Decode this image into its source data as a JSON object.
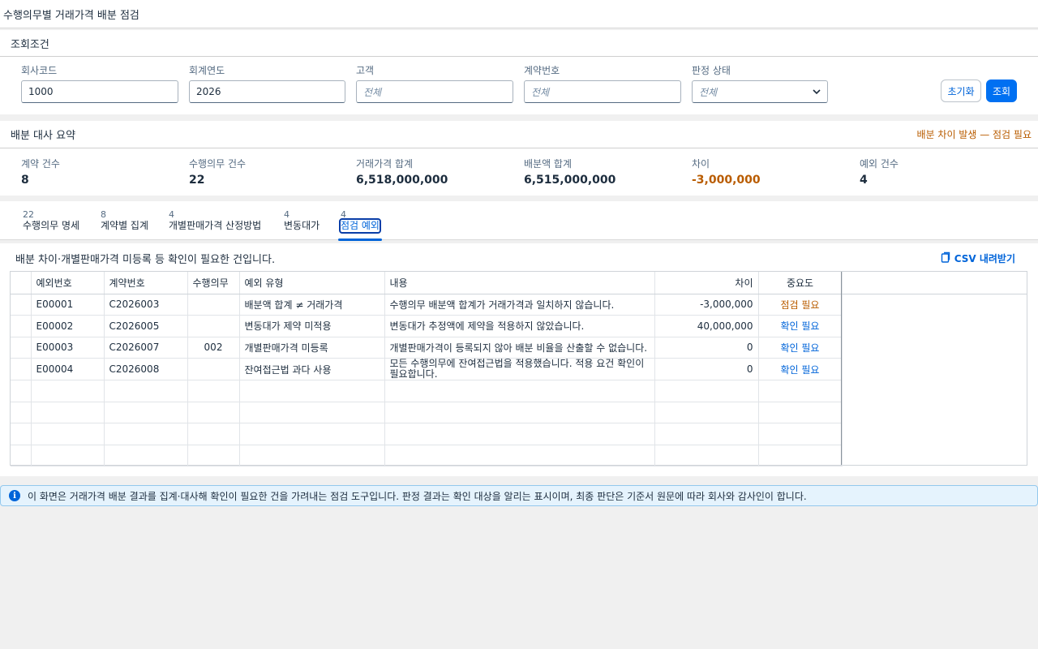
{
  "app": {
    "title": "수행의무별 거래가격 배분 점검"
  },
  "filter": {
    "header": "조회조건",
    "fields": [
      {
        "label": "회사코드",
        "value": "1000"
      },
      {
        "label": "회계연도",
        "value": "2026"
      },
      {
        "label": "고객",
        "placeholder": "전체"
      },
      {
        "label": "계약번호",
        "placeholder": "전체"
      },
      {
        "label": "판정 상태",
        "placeholder": "전체"
      }
    ],
    "reset_label": "초기화",
    "search_label": "조회"
  },
  "summary": {
    "header": "배분 대사 요약",
    "warning": "배분 차이 발생 — 점검 필요",
    "kpis": [
      {
        "label": "계약 건수",
        "value": "8"
      },
      {
        "label": "수행의무 건수",
        "value": "22"
      },
      {
        "label": "거래가격 합계",
        "value": "6,518,000,000"
      },
      {
        "label": "배분액 합계",
        "value": "6,515,000,000"
      },
      {
        "label": "차이",
        "value": "-3,000,000"
      },
      {
        "label": "예외 건수",
        "value": "4"
      }
    ]
  },
  "tabs": [
    {
      "count": "22",
      "label": "수행의무 명세"
    },
    {
      "count": "8",
      "label": "계약별 집계"
    },
    {
      "count": "4",
      "label": "개별판매가격 산정방법"
    },
    {
      "count": "4",
      "label": "변동대가"
    },
    {
      "count": "4",
      "label": "점검 예외"
    }
  ],
  "exceptions": {
    "description": "배분 차이·개별판매가격 미등록 등 확인이 필요한 건입니다.",
    "csv_label": "CSV 내려받기",
    "columns": [
      "예외번호",
      "계약번호",
      "수행의무",
      "예외 유형",
      "내용",
      "차이",
      "중요도"
    ],
    "rows": [
      {
        "id": "E00001",
        "contract": "C2026003",
        "obligation": "",
        "type": "배분액 합계 ≠ 거래가격",
        "content": "수행의무 배분액 합계가 거래가격과 일치하지 않습니다.",
        "diff": "-3,000,000",
        "severity": "점검 필요"
      },
      {
        "id": "E00002",
        "contract": "C2026005",
        "obligation": "",
        "type": "변동대가 제약 미적용",
        "content": "변동대가 추정액에 제약을 적용하지 않았습니다.",
        "diff": "40,000,000",
        "severity": "확인 필요"
      },
      {
        "id": "E00003",
        "contract": "C2026007",
        "obligation": "002",
        "type": "개별판매가격 미등록",
        "content": "개별판매가격이 등록되지 않아 배분 비율을 산출할 수 없습니다.",
        "diff": "0",
        "severity": "확인 필요"
      },
      {
        "id": "E00004",
        "contract": "C2026008",
        "obligation": "",
        "type": "잔여접근법 과다 사용",
        "content": "모든 수행의무에 잔여접근법을 적용했습니다. 적용 요건 확인이 필요합니다.",
        "diff": "0",
        "severity": "확인 필요"
      }
    ]
  },
  "message": "이 화면은 거래가격 배분 결과를 집계·대사해 확인이 필요한 건을 가려내는 점검 도구입니다. 판정 결과는 확인 대상을 알리는 표시이며, 최종 판단은 기준서 원문에 따라 회사와 감사인이 합니다."
}
